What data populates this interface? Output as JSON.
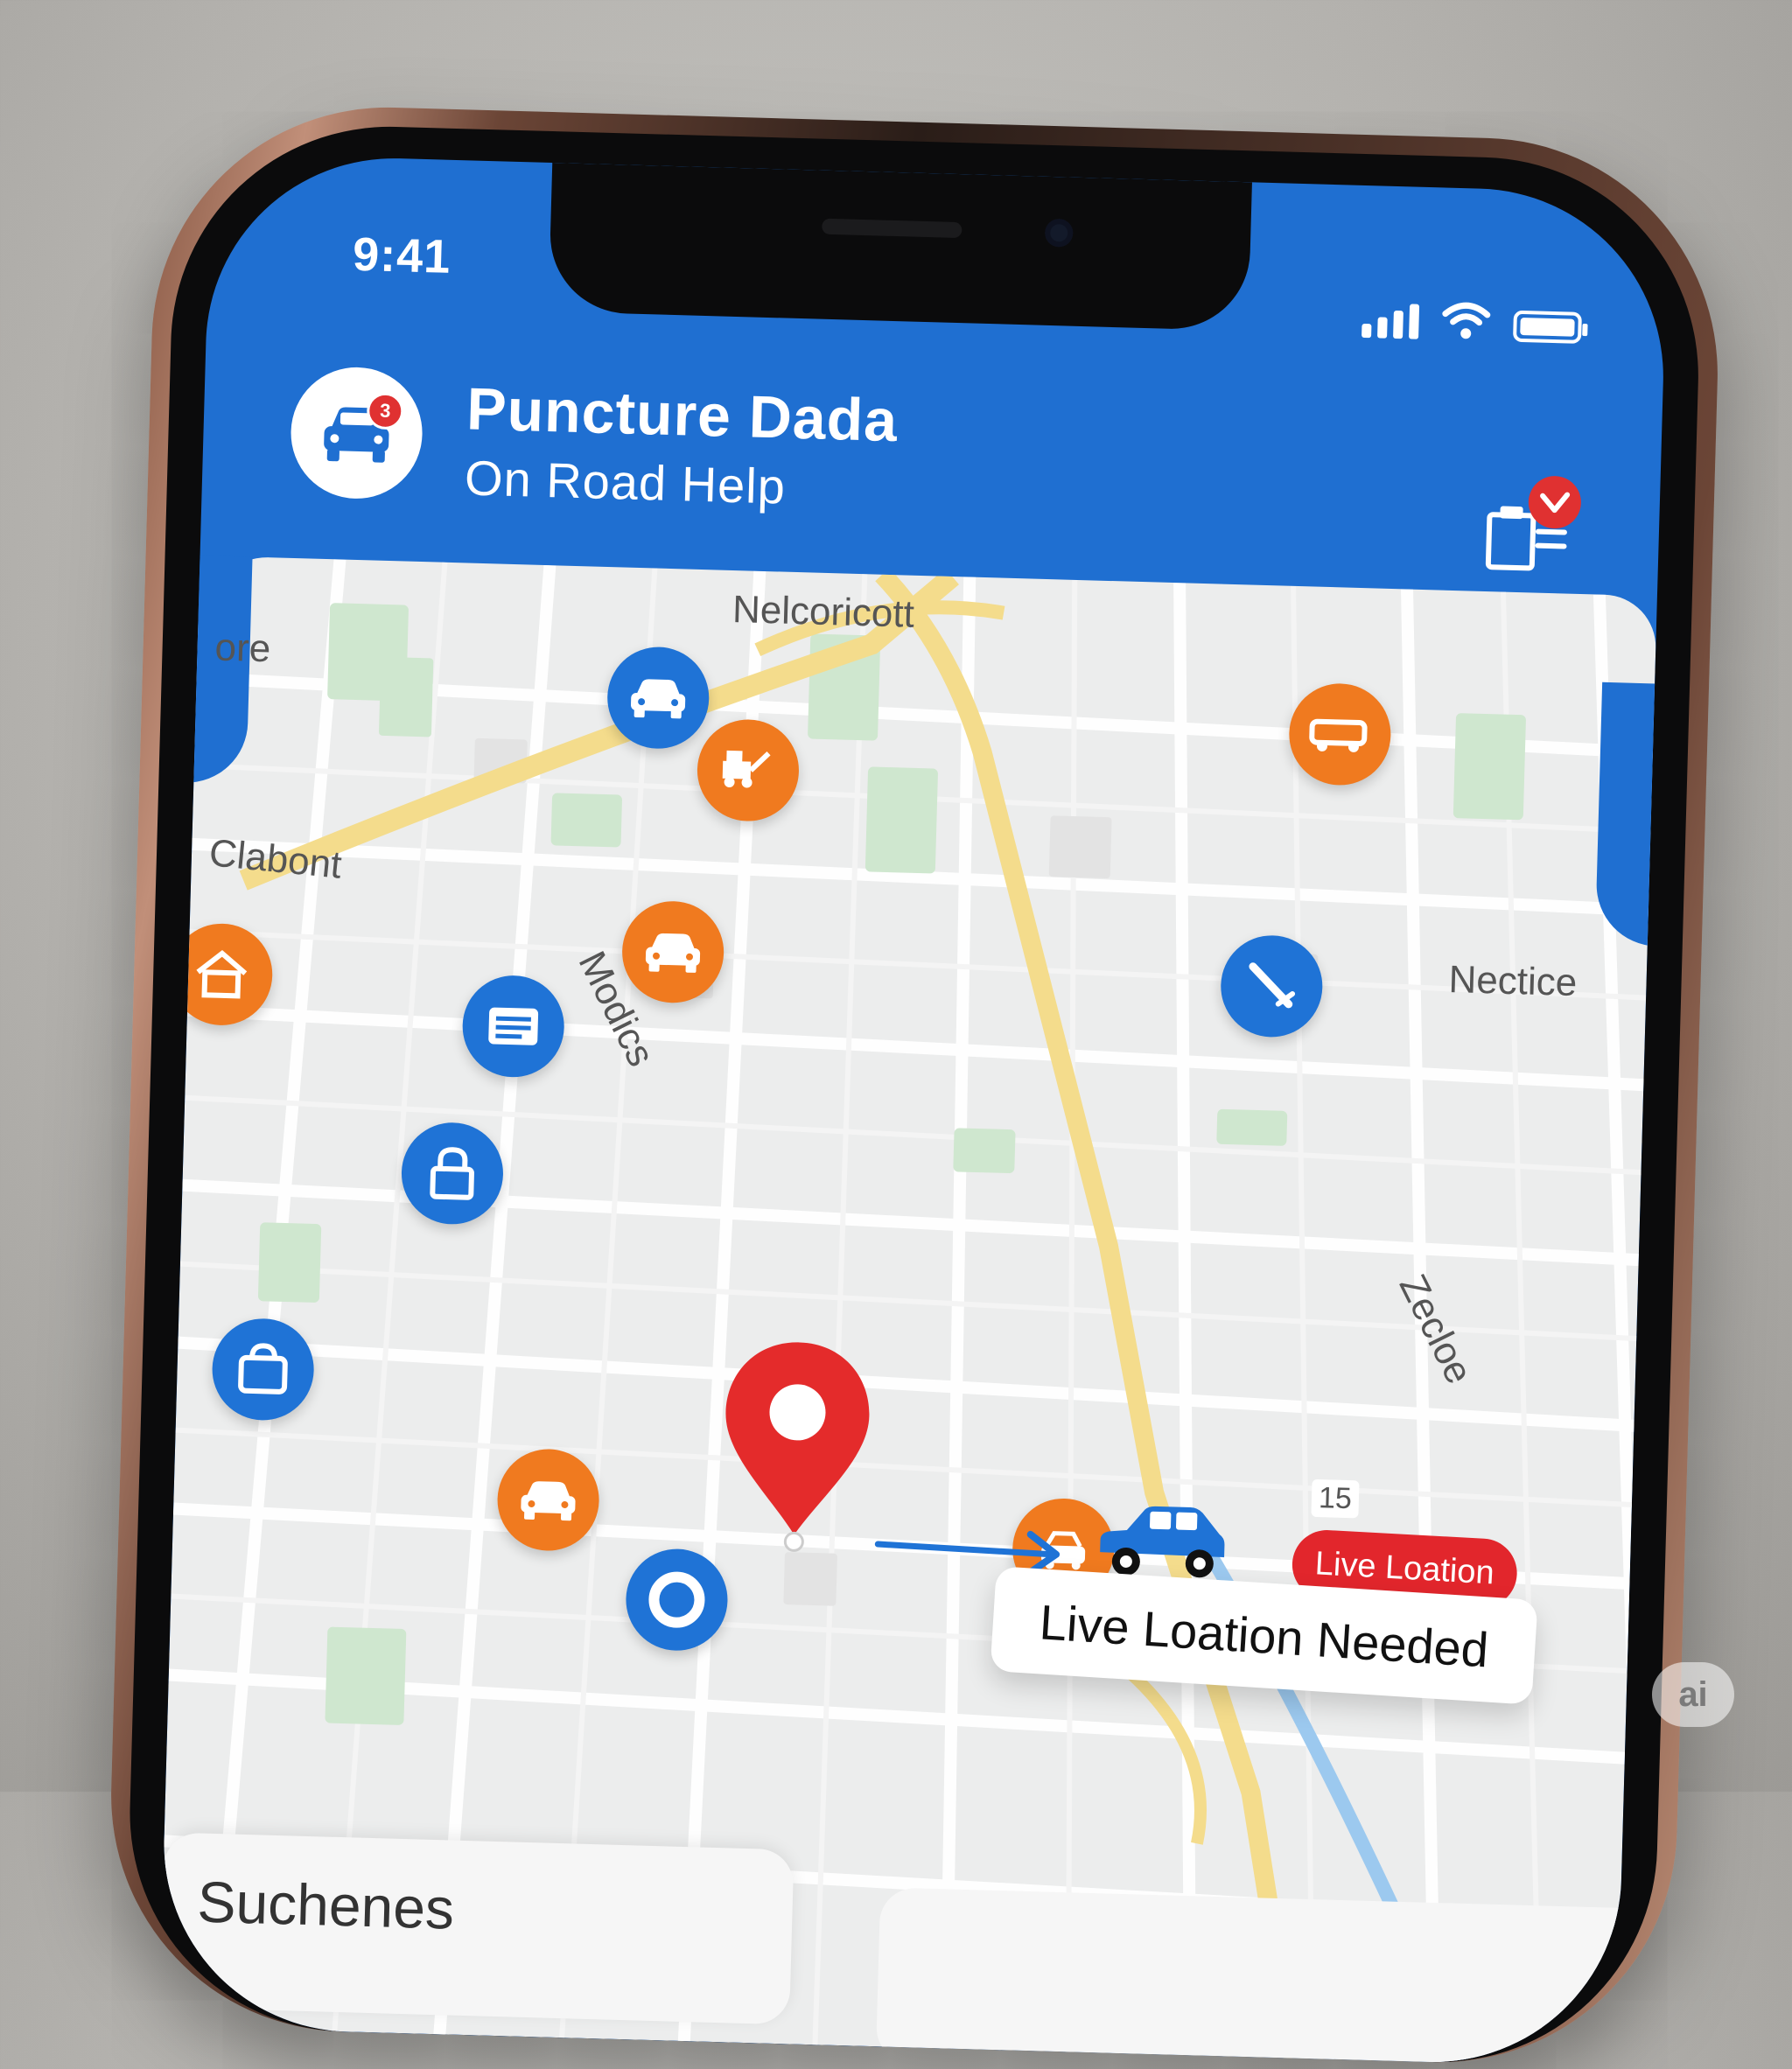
{
  "status_bar": {
    "time": "9:41"
  },
  "app": {
    "title": "Puncture Dada",
    "subtitle": "On Road Help",
    "logo_badge": "3",
    "logo_icon": "car-icon",
    "action_icon": "clipboard-check-icon"
  },
  "map": {
    "labels": {
      "top": "Nelcoricott",
      "left_top": "ore",
      "left": "Clabont",
      "street": "Modics",
      "right": "Nectice",
      "river": "Zecloe",
      "route_number": "15"
    },
    "pois": [
      {
        "icon": "car-front-icon",
        "color": "blue"
      },
      {
        "icon": "tow-truck-icon",
        "color": "orange"
      },
      {
        "icon": "flatbed-tow-icon",
        "color": "orange"
      },
      {
        "icon": "car-front-icon",
        "color": "orange"
      },
      {
        "icon": "house-repair-icon",
        "color": "orange"
      },
      {
        "icon": "wrench-icon",
        "color": "blue"
      },
      {
        "icon": "fuel-card-icon",
        "color": "blue"
      },
      {
        "icon": "lock-icon",
        "color": "blue"
      },
      {
        "icon": "bag-icon",
        "color": "blue"
      },
      {
        "icon": "car-front-icon",
        "color": "orange"
      },
      {
        "icon": "tire-icon",
        "color": "blue"
      },
      {
        "icon": "mechanic-icon",
        "color": "orange"
      }
    ],
    "live_location_pill": "Live Loation",
    "callout": "Live Loation Needed"
  },
  "bottom_sheet": {
    "search_label": "Suchenes"
  },
  "watermark": "ai",
  "colors": {
    "brand_blue": "#1f6fd1",
    "accent_orange": "#f07a1f",
    "alert_red": "#e2262c"
  }
}
